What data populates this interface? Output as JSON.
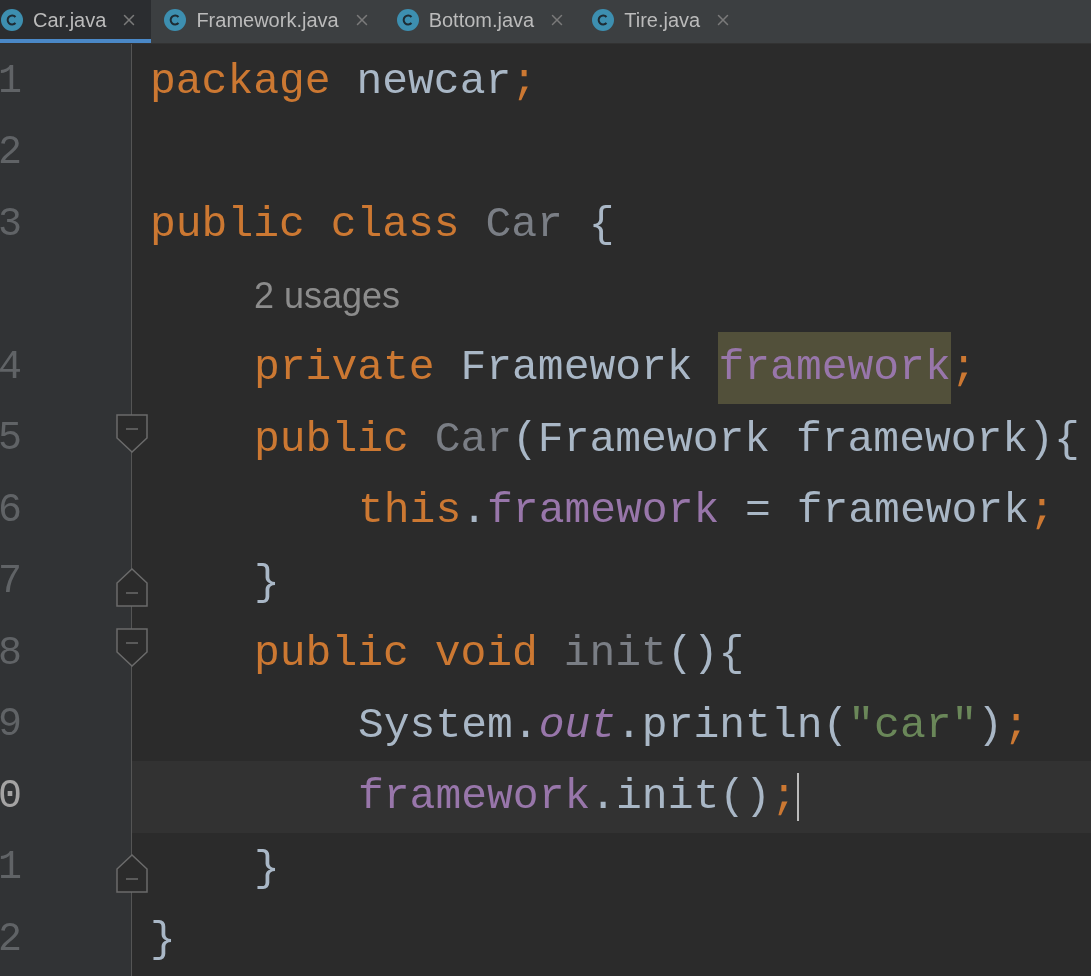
{
  "tabs": [
    {
      "label": "Car.java",
      "selected": true
    },
    {
      "label": "Framework.java",
      "selected": false
    },
    {
      "label": "Bottom.java",
      "selected": false
    },
    {
      "label": "Tire.java",
      "selected": false
    }
  ],
  "lines": [
    {
      "kind": "code",
      "number": "1",
      "current": false,
      "tokens": [
        {
          "text": "package",
          "kind": "keyword"
        },
        {
          "text": " newcar",
          "kind": "plain"
        },
        {
          "text": ";",
          "kind": "keyword"
        }
      ]
    },
    {
      "kind": "code",
      "number": "2",
      "current": false
    },
    {
      "kind": "code",
      "number": "3",
      "current": false,
      "tokens": [
        {
          "text": "public class ",
          "kind": "keyword"
        },
        {
          "text": "Car",
          "kind": "unused"
        },
        {
          "text": " {",
          "kind": "plain"
        }
      ],
      "children": [
        {
          "kind": "inlay",
          "text": "2 usages"
        },
        {
          "kind": "code",
          "number": "4",
          "current": false,
          "tokens": [
            {
              "text": "private ",
              "kind": "keyword"
            },
            {
              "text": "Framework ",
              "kind": "plain"
            },
            {
              "text": "framework",
              "kind": "usage_highlight"
            },
            {
              "text": ";",
              "kind": "keyword"
            }
          ]
        },
        {
          "kind": "code",
          "number": "5",
          "fold_start": true,
          "current": false,
          "tokens": [
            {
              "text": "public ",
              "kind": "keyword"
            },
            {
              "text": "Car",
              "kind": "unused"
            },
            {
              "text": "(Framework framework){",
              "kind": "plain"
            }
          ],
          "children": [
            {
              "kind": "code",
              "number": "6",
              "current": false,
              "tokens": [
                {
                  "text": "this",
                  "kind": "keyword"
                },
                {
                  "text": ".",
                  "kind": "plain"
                },
                {
                  "text": "framework",
                  "kind": "field"
                },
                {
                  "text": " = framework",
                  "kind": "plain"
                },
                {
                  "text": ";",
                  "kind": "keyword"
                }
              ]
            }
          ]
        },
        {
          "kind": "code",
          "number": "7",
          "fold_end": true,
          "current": false,
          "tokens": [
            {
              "text": "}",
              "kind": "plain"
            }
          ]
        },
        {
          "kind": "code",
          "number": "8",
          "fold_start": true,
          "current": false,
          "tokens": [
            {
              "text": "public void ",
              "kind": "keyword"
            },
            {
              "text": "init",
              "kind": "unused"
            },
            {
              "text": "(){",
              "kind": "plain"
            }
          ],
          "children": [
            {
              "kind": "code",
              "number": "9",
              "current": false,
              "tokens": [
                {
                  "text": "System.",
                  "kind": "plain"
                },
                {
                  "text": "out",
                  "kind": "static"
                },
                {
                  "text": ".println(",
                  "kind": "plain"
                },
                {
                  "text": "\"car\"",
                  "kind": "string"
                },
                {
                  "text": ")",
                  "kind": "plain"
                },
                {
                  "text": ";",
                  "kind": "keyword"
                }
              ]
            },
            {
              "kind": "code",
              "number": "0",
              "current": true,
              "tokens": [
                {
                  "text": "framework",
                  "kind": "field"
                },
                {
                  "text": ".init()",
                  "kind": "plain"
                },
                {
                  "text": ";",
                  "kind": "keyword"
                }
              ]
            }
          ]
        },
        {
          "kind": "code",
          "number": "1",
          "fold_end": true,
          "current": false,
          "tokens": [
            {
              "text": "}",
              "kind": "plain"
            }
          ]
        }
      ]
    },
    {
      "kind": "code",
      "number": "2",
      "current": false,
      "tokens": [
        {
          "text": "}",
          "kind": "plain"
        }
      ]
    }
  ]
}
